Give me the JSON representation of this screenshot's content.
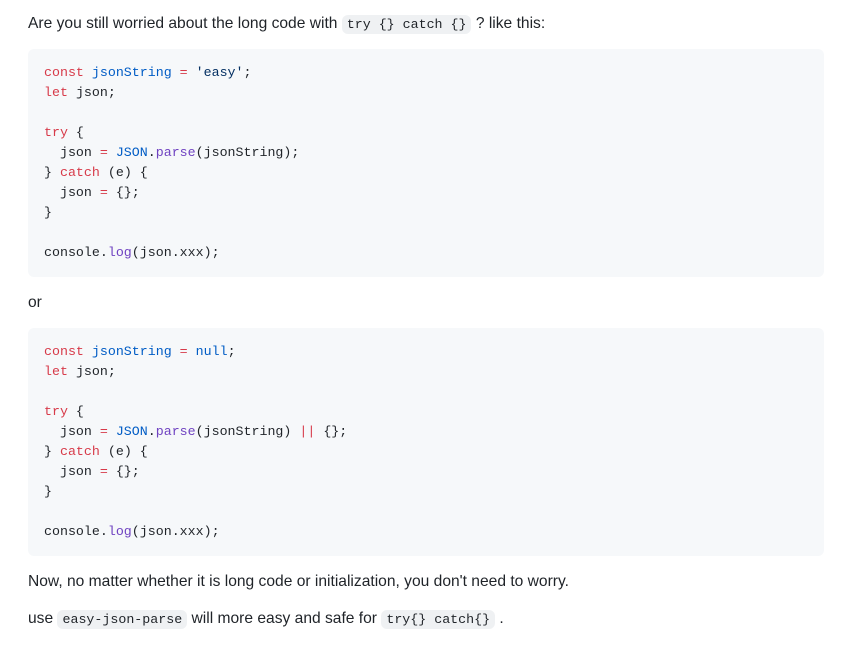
{
  "intro": {
    "before": "Are you still worried about the long code with ",
    "code": "try {} catch {}",
    "after": " ? like this:"
  },
  "code1": [
    [
      {
        "c": "#d73a49",
        "t": "const"
      },
      {
        "c": null,
        "t": " "
      },
      {
        "c": "#005cc5",
        "t": "jsonString"
      },
      {
        "c": null,
        "t": " "
      },
      {
        "c": "#d73a49",
        "t": "="
      },
      {
        "c": null,
        "t": " "
      },
      {
        "c": "#032f62",
        "t": "'easy'"
      },
      {
        "c": null,
        "t": ";"
      }
    ],
    [
      {
        "c": "#d73a49",
        "t": "let"
      },
      {
        "c": null,
        "t": " "
      },
      {
        "c": null,
        "t": "json;"
      }
    ],
    [],
    [
      {
        "c": "#d73a49",
        "t": "try"
      },
      {
        "c": null,
        "t": " {"
      }
    ],
    [
      {
        "c": null,
        "t": "  json "
      },
      {
        "c": "#d73a49",
        "t": "="
      },
      {
        "c": null,
        "t": " "
      },
      {
        "c": "#005cc5",
        "t": "JSON"
      },
      {
        "c": null,
        "t": "."
      },
      {
        "c": "#6f42c1",
        "t": "parse"
      },
      {
        "c": null,
        "t": "(jsonString);"
      }
    ],
    [
      {
        "c": null,
        "t": "} "
      },
      {
        "c": "#d73a49",
        "t": "catch"
      },
      {
        "c": null,
        "t": " (e) {"
      }
    ],
    [
      {
        "c": null,
        "t": "  json "
      },
      {
        "c": "#d73a49",
        "t": "="
      },
      {
        "c": null,
        "t": " {};"
      }
    ],
    [
      {
        "c": null,
        "t": "}"
      }
    ],
    [],
    [
      {
        "c": null,
        "t": "console."
      },
      {
        "c": "#6f42c1",
        "t": "log"
      },
      {
        "c": null,
        "t": "(json.xxx);"
      }
    ]
  ],
  "or_text": "or",
  "code2": [
    [
      {
        "c": "#d73a49",
        "t": "const"
      },
      {
        "c": null,
        "t": " "
      },
      {
        "c": "#005cc5",
        "t": "jsonString"
      },
      {
        "c": null,
        "t": " "
      },
      {
        "c": "#d73a49",
        "t": "="
      },
      {
        "c": null,
        "t": " "
      },
      {
        "c": "#005cc5",
        "t": "null"
      },
      {
        "c": null,
        "t": ";"
      }
    ],
    [
      {
        "c": "#d73a49",
        "t": "let"
      },
      {
        "c": null,
        "t": " "
      },
      {
        "c": null,
        "t": "json;"
      }
    ],
    [],
    [
      {
        "c": "#d73a49",
        "t": "try"
      },
      {
        "c": null,
        "t": " {"
      }
    ],
    [
      {
        "c": null,
        "t": "  json "
      },
      {
        "c": "#d73a49",
        "t": "="
      },
      {
        "c": null,
        "t": " "
      },
      {
        "c": "#005cc5",
        "t": "JSON"
      },
      {
        "c": null,
        "t": "."
      },
      {
        "c": "#6f42c1",
        "t": "parse"
      },
      {
        "c": null,
        "t": "(jsonString) "
      },
      {
        "c": "#d73a49",
        "t": "||"
      },
      {
        "c": null,
        "t": " {};"
      }
    ],
    [
      {
        "c": null,
        "t": "} "
      },
      {
        "c": "#d73a49",
        "t": "catch"
      },
      {
        "c": null,
        "t": " (e) {"
      }
    ],
    [
      {
        "c": null,
        "t": "  json "
      },
      {
        "c": "#d73a49",
        "t": "="
      },
      {
        "c": null,
        "t": " {};"
      }
    ],
    [
      {
        "c": null,
        "t": "}"
      }
    ],
    [],
    [
      {
        "c": null,
        "t": "console."
      },
      {
        "c": "#6f42c1",
        "t": "log"
      },
      {
        "c": null,
        "t": "(json.xxx);"
      }
    ]
  ],
  "outro1": "Now, no matter whether it is long code or initialization, you don't need to worry.",
  "outro2": {
    "before": "use ",
    "code1": "easy-json-parse",
    "mid": " will more easy and safe for ",
    "code2": "try{} catch{}",
    "after": " ."
  }
}
